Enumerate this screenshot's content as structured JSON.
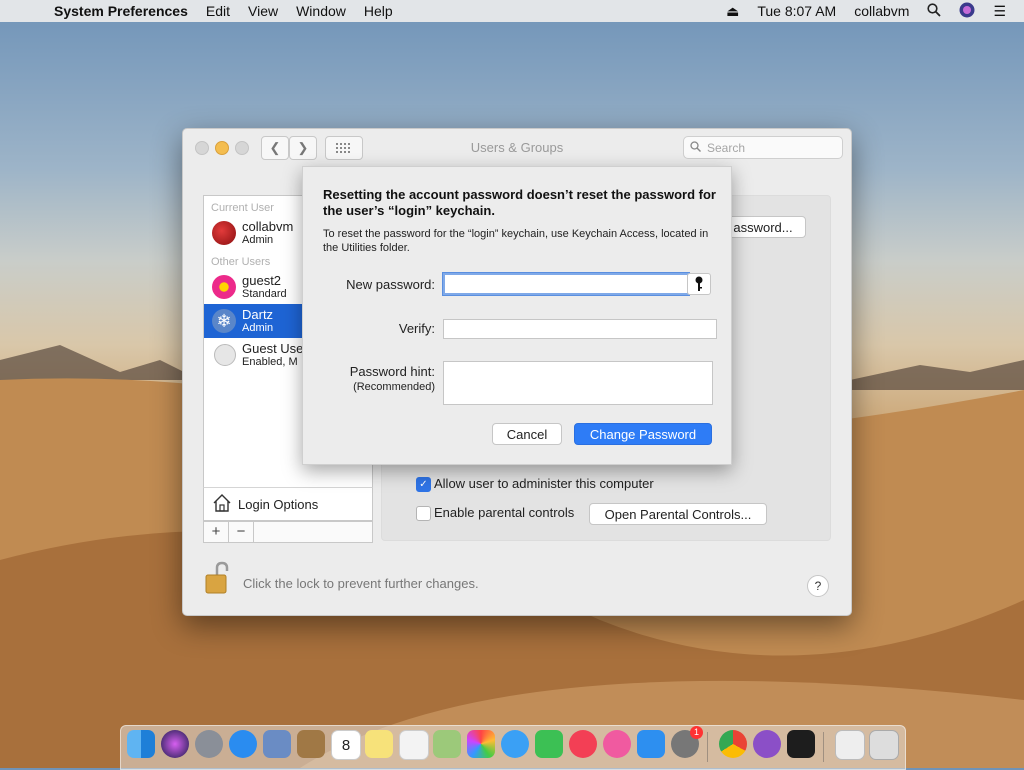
{
  "menubar": {
    "app_name": "System Preferences",
    "menus": [
      "Edit",
      "View",
      "Window",
      "Help"
    ],
    "clock": "Tue 8:07 AM",
    "username": "collabvm"
  },
  "window": {
    "title": "Users & Groups",
    "search_placeholder": "Search"
  },
  "user_list": {
    "current_user_header": "Current User",
    "other_users_header": "Other Users",
    "users": [
      {
        "name": "collabvm",
        "role": "Admin"
      },
      {
        "name": "guest2",
        "role": "Standard"
      },
      {
        "name": "Dartz",
        "role": "Admin"
      },
      {
        "name": "Guest Use",
        "role": "Enabled, M"
      }
    ],
    "login_options": "Login Options",
    "add_label": "+",
    "remove_label": "−"
  },
  "right_panel": {
    "change_password_partial": "assword...",
    "allow_admin_label": "Allow user to administer this computer",
    "parental_controls_label": "Enable parental controls",
    "open_parental_button": "Open Parental Controls..."
  },
  "footer": {
    "lock_text": "Click the lock to prevent further changes.",
    "help_label": "?"
  },
  "sheet": {
    "heading": "Resetting the account password doesn’t reset the password for the user’s “login” keychain.",
    "info": "To reset the password for the “login” keychain, use Keychain Access, located in the Utilities folder.",
    "new_password_label": "New password:",
    "new_password_value": "",
    "verify_label": "Verify:",
    "verify_value": "",
    "hint_label": "Password hint:",
    "hint_sub_label": "(Recommended)",
    "hint_value": "",
    "cancel_label": "Cancel",
    "change_label": "Change Password"
  },
  "dock": {
    "calendar_day": "8",
    "badge_count": "1"
  },
  "colors": {
    "accent": "#2e7cf6",
    "selection": "#1e64d4"
  }
}
